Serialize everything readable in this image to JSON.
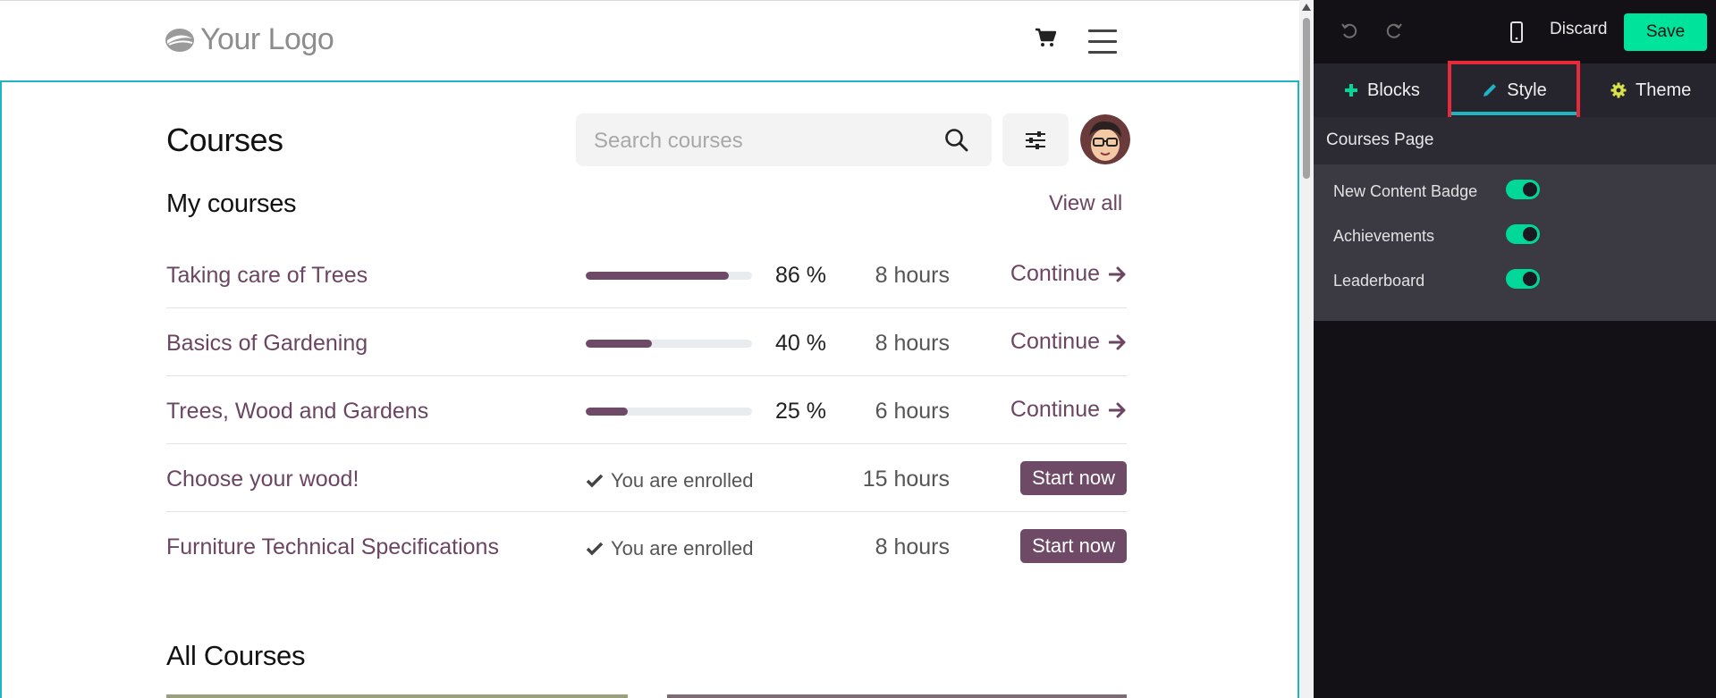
{
  "site": {
    "logo_text": "Your Logo",
    "page_title": "Courses",
    "search_placeholder": "Search courses",
    "my_courses_title": "My courses",
    "view_all": "View all",
    "courses": [
      {
        "name": "Taking care of Trees",
        "progress": 86,
        "progress_label": "86 %",
        "duration": "8 hours",
        "action": "Continue"
      },
      {
        "name": "Basics of Gardening",
        "progress": 40,
        "progress_label": "40 %",
        "duration": "8 hours",
        "action": "Continue"
      },
      {
        "name": "Trees, Wood and Gardens",
        "progress": 25,
        "progress_label": "25 %",
        "duration": "6 hours",
        "action": "Continue"
      },
      {
        "name": "Choose your wood!",
        "enrolled_label": "You are enrolled",
        "duration": "15 hours",
        "action": "Start now"
      },
      {
        "name": "Furniture Technical Specifications",
        "enrolled_label": "You are enrolled",
        "duration": "8 hours",
        "action": "Start now"
      }
    ],
    "all_courses_title": "All Courses"
  },
  "editor": {
    "discard_label": "Discard",
    "save_label": "Save",
    "tabs": [
      {
        "label": "Blocks",
        "icon": "plus-icon"
      },
      {
        "label": "Style",
        "icon": "pencil-icon",
        "active": true
      },
      {
        "label": "Theme",
        "icon": "gear-icon"
      }
    ],
    "section_title": "Courses Page",
    "options": [
      {
        "label": "New Content Badge",
        "enabled": true
      },
      {
        "label": "Achievements",
        "enabled": true
      },
      {
        "label": "Leaderboard",
        "enabled": true
      }
    ]
  },
  "colors": {
    "accent": "#6f4a67",
    "save": "#00e39b",
    "toggle_on": "#00d89a",
    "editable_border": "#1fb4c4",
    "highlight": "#e52a3a"
  }
}
